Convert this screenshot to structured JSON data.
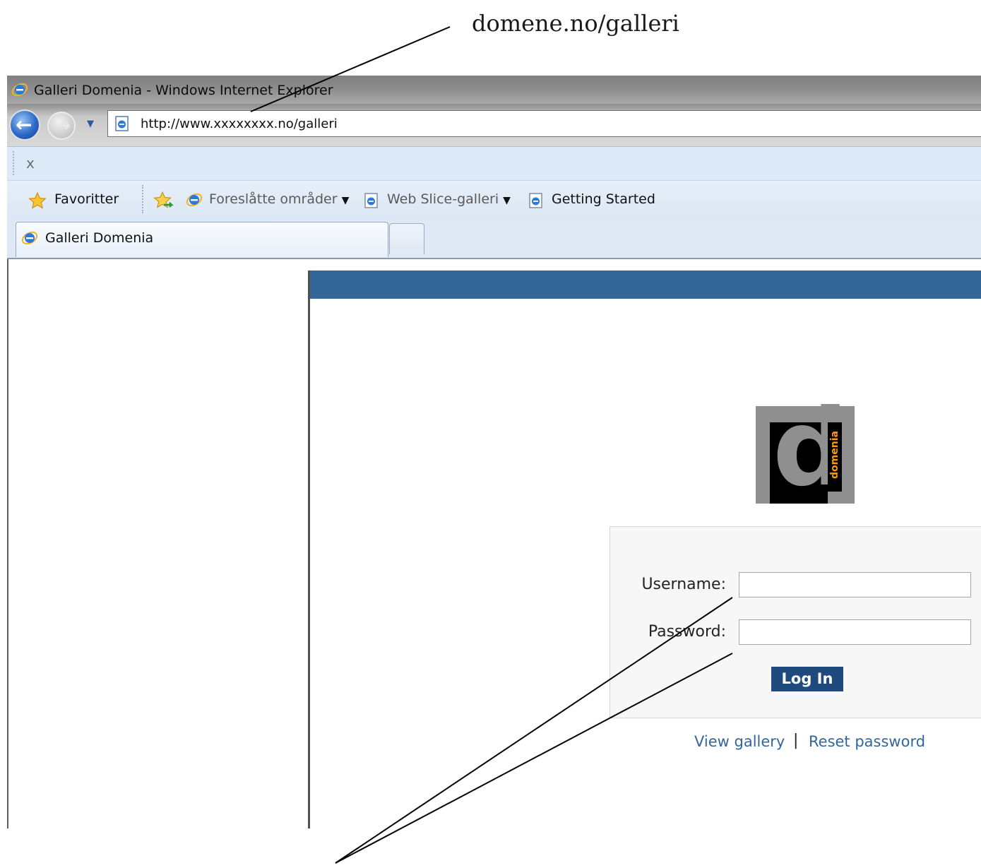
{
  "annotation": {
    "text": "domene.no/galleri"
  },
  "window": {
    "title": "Galleri Domenia - Windows Internet Explorer"
  },
  "navigation": {
    "address_url": "http://www.xxxxxxxx.no/galleri"
  },
  "command_bar": {
    "close_glyph": "x"
  },
  "favorites_bar": {
    "favorites_label": "Favoritter",
    "items": [
      {
        "label": "Foreslåtte områder",
        "has_dropdown": true,
        "enabled": false
      },
      {
        "label": "Web Slice-galleri",
        "has_dropdown": true,
        "enabled": false
      },
      {
        "label": "Getting Started",
        "has_dropdown": false,
        "enabled": true
      }
    ]
  },
  "tabs": [
    {
      "label": "Galleri Domenia",
      "active": true
    }
  ],
  "page": {
    "header_color": "#336699",
    "logo": {
      "letter": "d",
      "word": "domenia",
      "accent_color": "#ff9900"
    },
    "login": {
      "username_label": "Username:",
      "password_label": "Password:",
      "username_value": "",
      "password_value": "",
      "submit_label": "Log In"
    },
    "links": {
      "view_gallery": "View gallery",
      "separator": "|",
      "reset_password": "Reset password"
    }
  }
}
